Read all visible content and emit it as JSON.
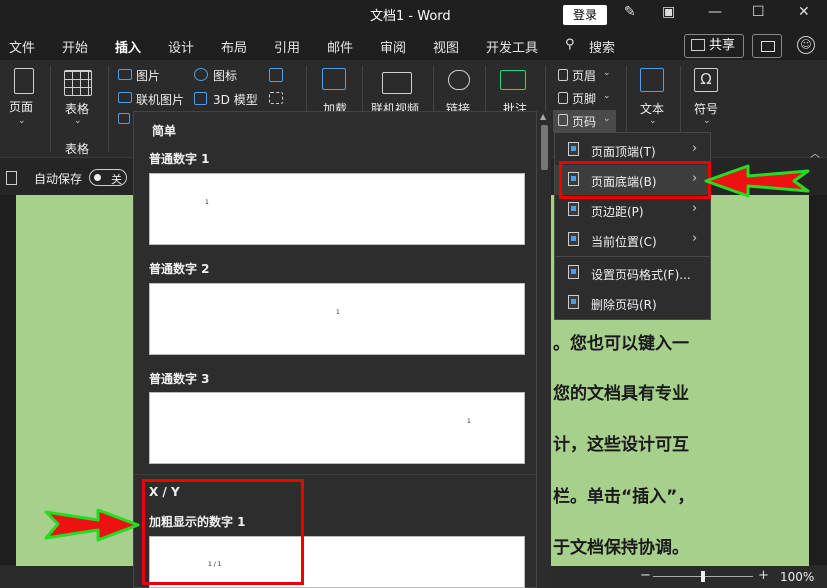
{
  "titlebar": {
    "title": "文档1  -  Word",
    "login": "登录"
  },
  "tabs": [
    "文件",
    "开始",
    "插入",
    "设计",
    "布局",
    "引用",
    "邮件",
    "审阅",
    "视图",
    "开发工具",
    "搜索"
  ],
  "share": "共享",
  "ribbon": {
    "page": "页面",
    "table": "表格",
    "table_group": "表格",
    "picture": "图片",
    "online_picture": "联机图片",
    "icons": "图标",
    "model3d": "3D 模型",
    "addins": "加载",
    "online_video": "联机视频",
    "link": "链接",
    "comment": "批注",
    "header": "页眉",
    "footer": "页脚",
    "page_number": "页码",
    "text": "文本",
    "symbol": "符号"
  },
  "autosave": {
    "label": "自动保存",
    "state": "关"
  },
  "gallery": {
    "section_simple": "简单",
    "items": [
      {
        "label": "普通数字 1",
        "num": "1"
      },
      {
        "label": "普通数字 2",
        "num": "1"
      },
      {
        "label": "普通数字 3",
        "num": "1"
      }
    ],
    "section_xy": "X / Y",
    "xy_items": [
      {
        "label": "加粗显示的数字 1",
        "num": "1 / 1"
      }
    ]
  },
  "page_number_menu": [
    {
      "label": "页面顶端(T)",
      "submenu": true
    },
    {
      "label": "页面底端(B)",
      "submenu": true
    },
    {
      "label": "页边距(P)",
      "submenu": true
    },
    {
      "label": "当前位置(C)",
      "submenu": true
    },
    {
      "label": "设置页码格式(F)...",
      "submenu": false
    },
    {
      "label": "删除页码(R)",
      "submenu": false
    }
  ],
  "document": {
    "lines": [
      "。您也可以键入一",
      "您的文档具有专业",
      "计，这些设计可互",
      "栏。单击“插入”，",
      "于文档保持协调。"
    ]
  },
  "status": {
    "zoom": "100%"
  },
  "colors": {
    "page": "#a8d08d",
    "highlight": "#ee0000",
    "arrow": "#22dd22"
  }
}
